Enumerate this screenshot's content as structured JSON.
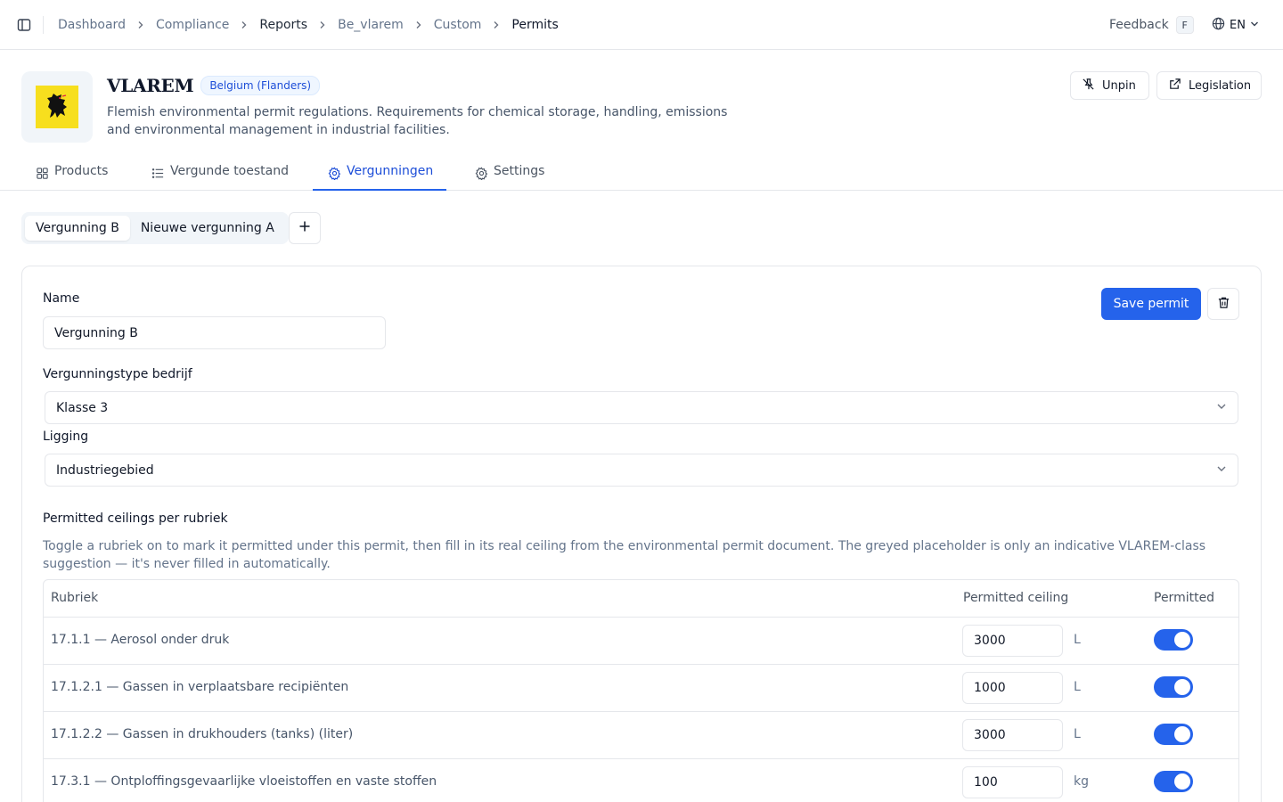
{
  "breadcrumb": [
    "Dashboard",
    "Compliance",
    "Reports",
    "Be_vlarem",
    "Custom",
    "Permits"
  ],
  "topbar": {
    "feedback": "Feedback",
    "feedback_key": "F",
    "language": "EN"
  },
  "header": {
    "title": "VLAREM",
    "region": "Belgium (Flanders)",
    "description": "Flemish environmental permit regulations. Requirements for chemical storage, handling, emissions and environmental management in industrial facilities.",
    "unpin": "Unpin",
    "legislation": "Legislation"
  },
  "tabs": [
    "Products",
    "Vergunde toestand",
    "Vergunningen",
    "Settings"
  ],
  "active_tab": "Vergunningen",
  "permit_tabs": [
    "Vergunning B",
    "Nieuwe vergunning A"
  ],
  "form": {
    "name_label": "Name",
    "name_value": "Vergunning B",
    "type_label": "Vergunningstype bedrijf",
    "type_value": "Klasse 3",
    "location_label": "Ligging",
    "location_value": "Industriegebied",
    "save": "Save permit"
  },
  "ceilings": {
    "title": "Permitted ceilings per rubriek",
    "description": "Toggle a rubriek on to mark it permitted under this permit, then fill in its real ceiling from the environmental permit document. The greyed placeholder is only an indicative VLAREM-class suggestion — it's never filled in automatically.",
    "columns": [
      "Rubriek",
      "Permitted ceiling",
      "Permitted"
    ],
    "rows": [
      {
        "name": "17.1.1 — Aerosol onder druk",
        "ceiling": "3000",
        "unit": "L",
        "permitted": true
      },
      {
        "name": "17.1.2.1 — Gassen in verplaatsbare recipiënten",
        "ceiling": "1000",
        "unit": "L",
        "permitted": true
      },
      {
        "name": "17.1.2.2 — Gassen in drukhouders (tanks) (liter)",
        "ceiling": "3000",
        "unit": "L",
        "permitted": true
      },
      {
        "name": "17.3.1 — Ontploffingsgevaarlijke vloeistoffen en vaste stoffen",
        "ceiling": "100",
        "unit": "kg",
        "permitted": true
      }
    ]
  }
}
